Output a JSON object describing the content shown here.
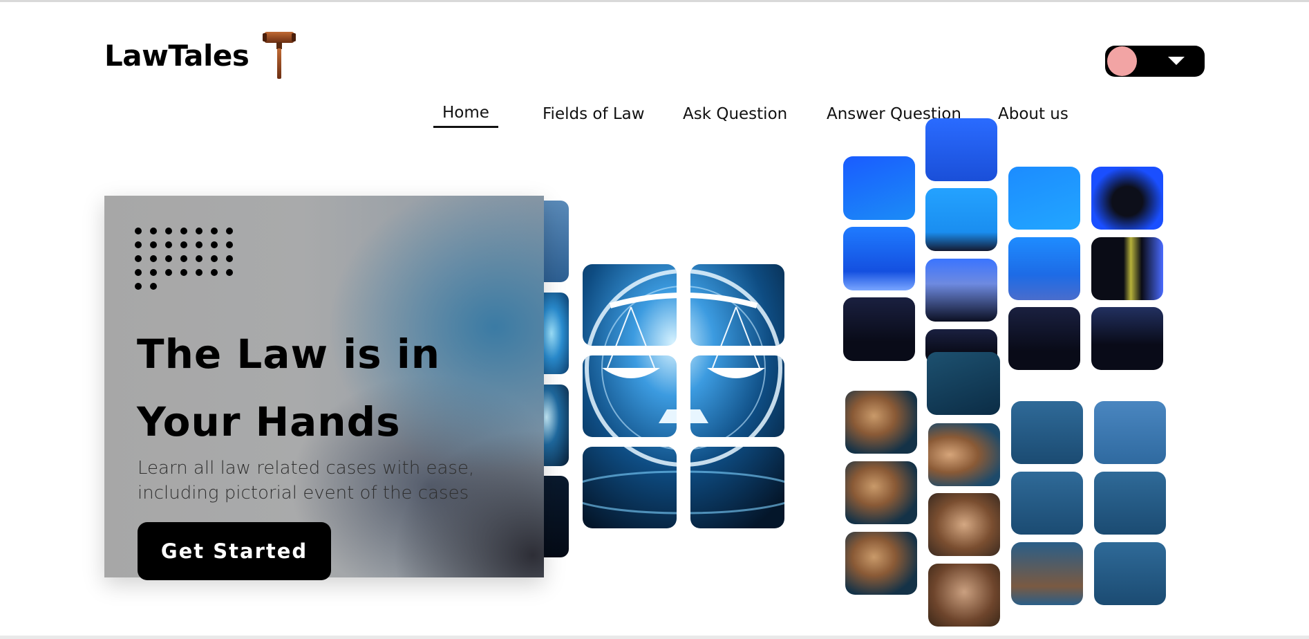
{
  "brand": {
    "name": "LawTales"
  },
  "nav": {
    "items": [
      {
        "label": "Home",
        "active": true
      },
      {
        "label": "Fields of Law",
        "active": false
      },
      {
        "label": "Ask Question",
        "active": false
      },
      {
        "label": "Answer Question",
        "active": false
      },
      {
        "label": "About us",
        "active": false
      }
    ]
  },
  "theme_toggle": {
    "knob_color": "#f2a4a4",
    "icon": "chevron-down-icon"
  },
  "hero": {
    "title": "The Law is in\nYour Hands",
    "subtitle": "Learn all law related cases with ease,\nincluding pictorial event of the cases",
    "cta_label": "Get Started"
  },
  "colors": {
    "accent": "#000000",
    "toggle_knob": "#f2a4a4",
    "background": "#ffffff"
  }
}
